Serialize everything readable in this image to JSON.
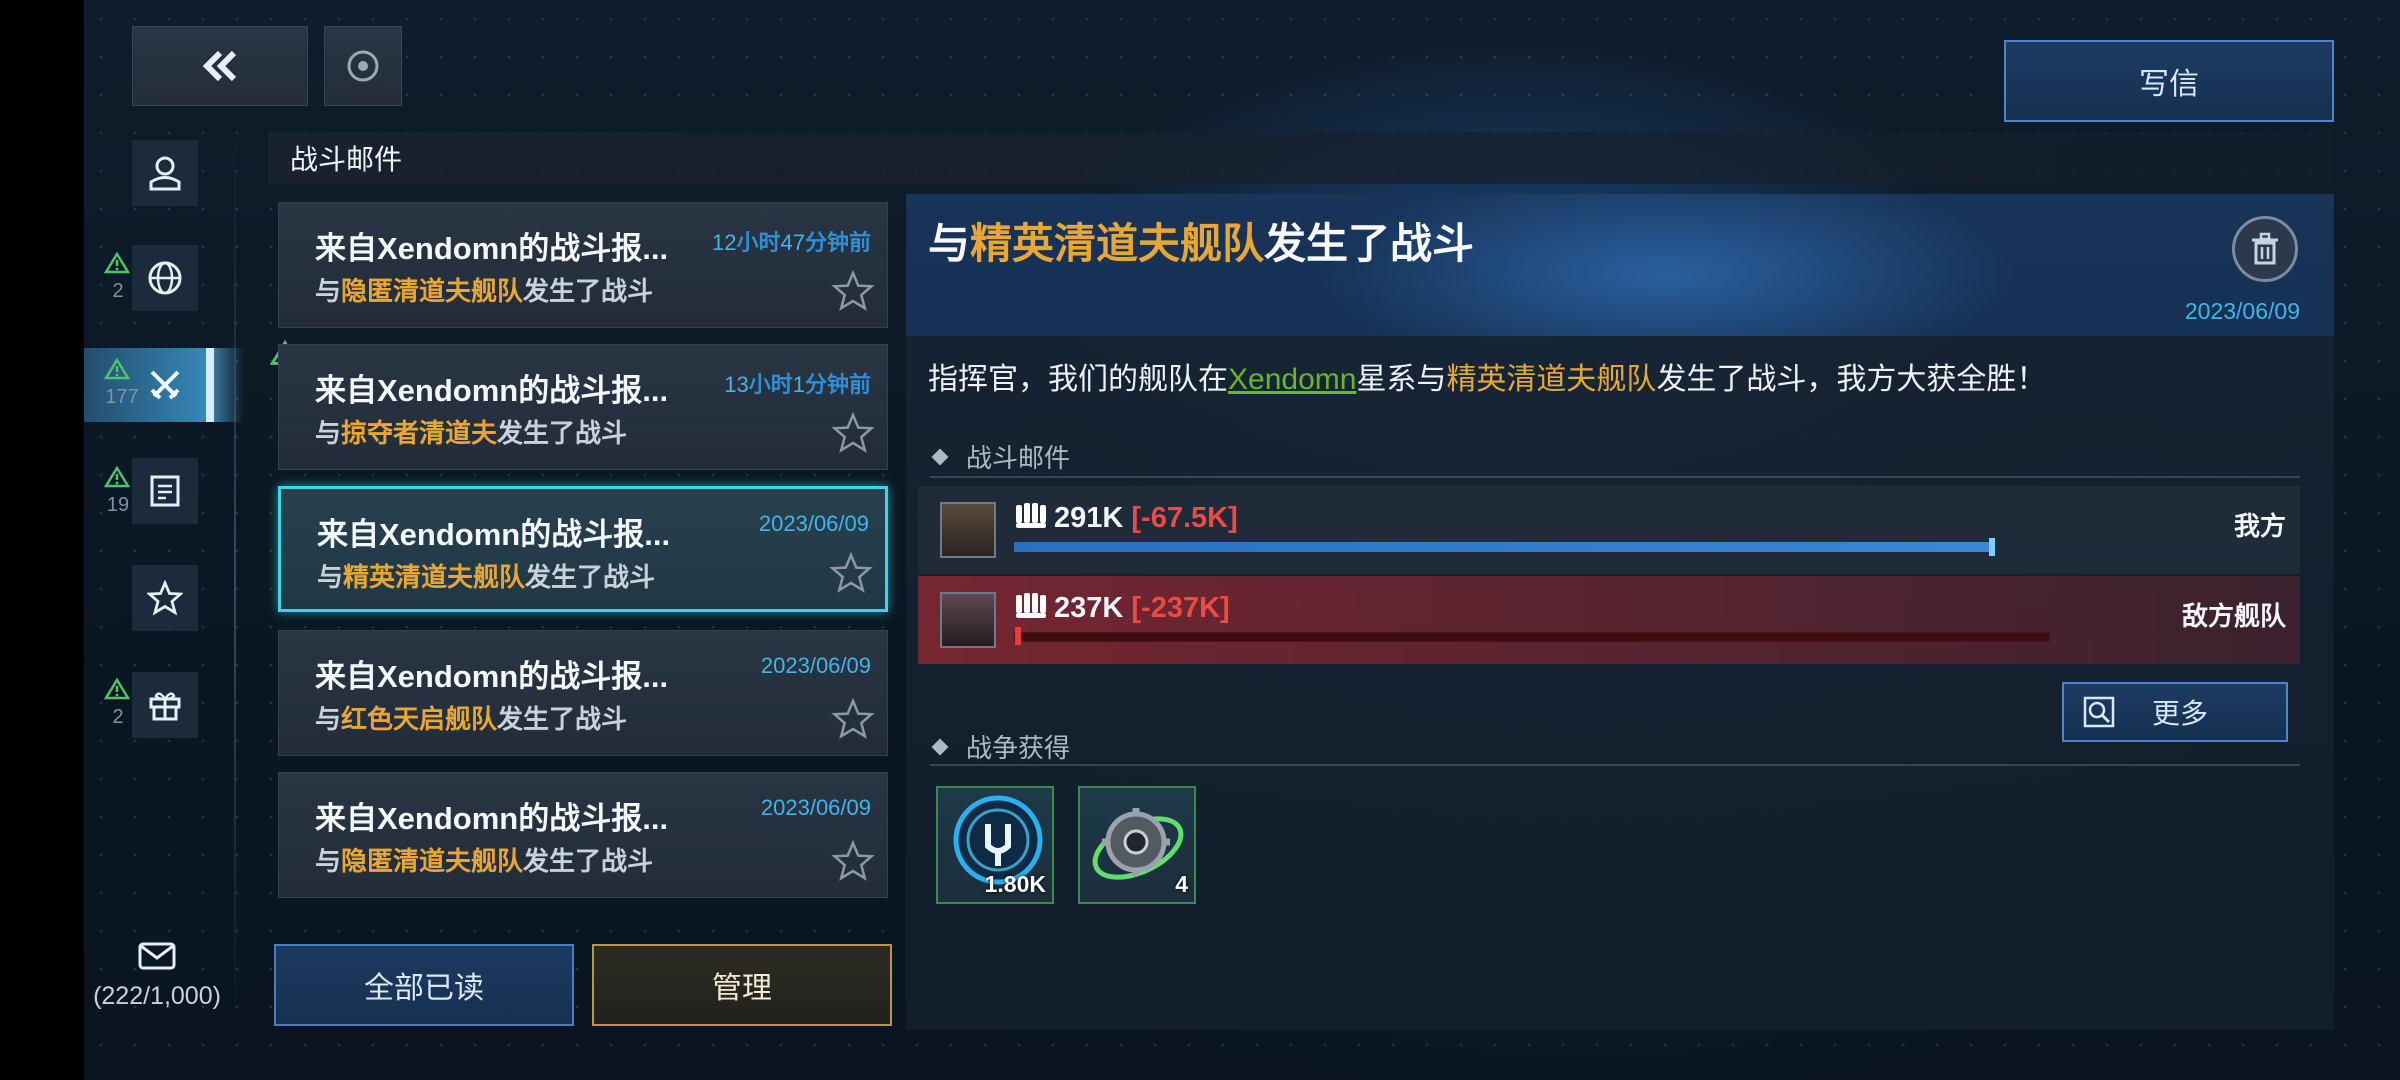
{
  "header": {
    "write_label": "写信",
    "section_title": "战斗邮件"
  },
  "nav": {
    "badges": [
      {
        "count": "2"
      },
      {
        "count": "177"
      },
      {
        "count": "19"
      },
      {
        "count": "2"
      }
    ],
    "mail_count": "(222/1,000)"
  },
  "mails": [
    {
      "title": "来自Xendomn的战斗报...",
      "time_num1": "12",
      "time_unit1": "小时",
      "time_num2": "47",
      "time_unit2": "分钟前",
      "sub_prefix": "与",
      "fleet": "隐匿清道夫舰队",
      "sub_suffix": "发生了战斗"
    },
    {
      "title": "来自Xendomn的战斗报...",
      "time_num1": "13",
      "time_unit1": "小时",
      "time_num2": "1",
      "time_unit2": "分钟前",
      "sub_prefix": "与",
      "fleet": "掠夺者清道夫",
      "sub_suffix": "发生了战斗"
    },
    {
      "title": "来自Xendomn的战斗报...",
      "time": "2023/06/09",
      "sub_prefix": "与",
      "fleet": "精英清道夫舰队",
      "sub_suffix": "发生了战斗"
    },
    {
      "title": "来自Xendomn的战斗报...",
      "time": "2023/06/09",
      "sub_prefix": "与",
      "fleet": "红色天启舰队",
      "sub_suffix": "发生了战斗"
    },
    {
      "title": "来自Xendomn的战斗报...",
      "time": "2023/06/09",
      "sub_prefix": "与",
      "fleet": "隐匿清道夫舰队",
      "sub_suffix": "发生了战斗"
    }
  ],
  "buttons": {
    "mark_all_read": "全部已读",
    "manage": "管理",
    "more": "更多"
  },
  "detail": {
    "title_prefix": "与",
    "title_fleet": "精英清道夫舰队",
    "title_suffix": "发生了战斗",
    "date": "2023/06/09",
    "msg_part1": "指挥官，我们的舰队在",
    "msg_link": "Xendomn",
    "msg_part2": "星系与",
    "msg_fleet": "精英清道夫舰队",
    "msg_part3": "发生了战斗，我方大获全胜！",
    "battle_section": "战斗邮件",
    "spoils_section": "战争获得",
    "mine": {
      "power": "291K",
      "loss": "[-67.5K]",
      "label": "我方",
      "remaining_fraction": 0.77
    },
    "enemy": {
      "power": "237K",
      "loss": "[-237K]",
      "label": "敌方舰队",
      "remaining_fraction": 0.0
    },
    "rewards": [
      {
        "icon": "energy-core-icon",
        "count": "1.80K"
      },
      {
        "icon": "gear-part-icon",
        "count": "4"
      }
    ]
  },
  "colors": {
    "accent_cyan": "#41b4ea",
    "highlight_orange": "#e8a735",
    "loss_red": "#ee4a44",
    "link_green": "#6ab52d"
  }
}
